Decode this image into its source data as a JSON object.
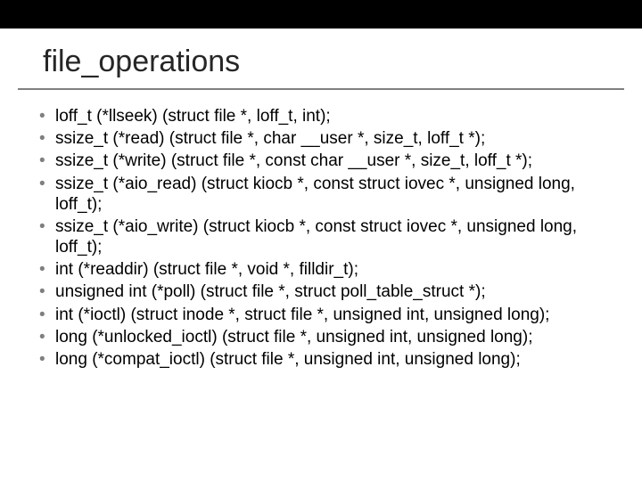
{
  "slide": {
    "title": "file_operations",
    "bullets": [
      "loff_t (*llseek) (struct file *, loff_t, int);",
      "ssize_t (*read) (struct file *, char __user *, size_t, loff_t *);",
      "ssize_t (*write) (struct file *, const char __user *, size_t, loff_t *);",
      "ssize_t (*aio_read) (struct kiocb *, const struct iovec *, unsigned long, loff_t);",
      "ssize_t (*aio_write) (struct kiocb *, const struct iovec *, unsigned long, loff_t);",
      "int (*readdir) (struct file *, void *, filldir_t);",
      "unsigned int (*poll) (struct file *, struct poll_table_struct *);",
      "int (*ioctl) (struct inode *, struct file *, unsigned int, unsigned long);",
      "long (*unlocked_ioctl) (struct file *, unsigned int, unsigned long);",
      "long (*compat_ioctl) (struct file *, unsigned int, unsigned long);"
    ]
  }
}
